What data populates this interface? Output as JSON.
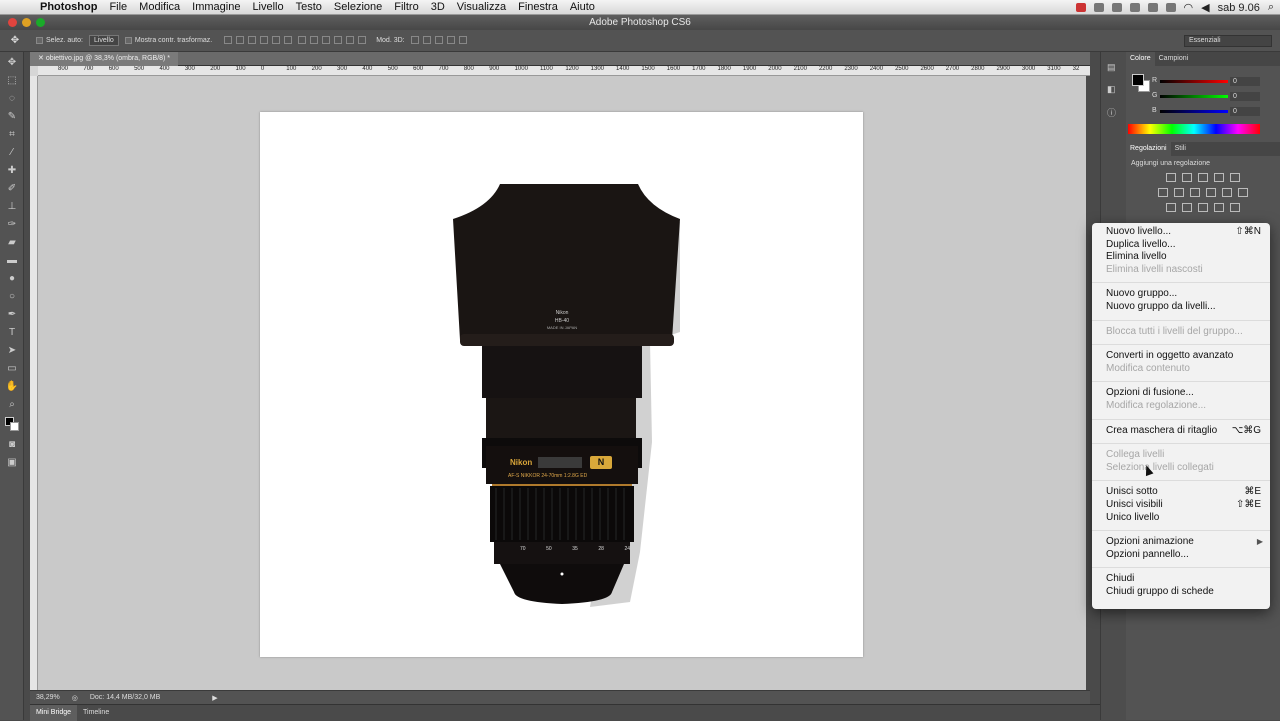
{
  "menubar": {
    "app_name": "Photoshop",
    "items": [
      "File",
      "Modifica",
      "Immagine",
      "Livello",
      "Testo",
      "Selezione",
      "Filtro",
      "3D",
      "Visualizza",
      "Finestra",
      "Aiuto"
    ],
    "clock": "sab 9.06"
  },
  "window": {
    "title": "Adobe Photoshop CS6"
  },
  "options_bar": {
    "auto_select_label": "Selez. auto:",
    "auto_select_value": "Livello",
    "transform_label": "Mostra contr. trasformaz.",
    "mode3d_label": "Mod. 3D:",
    "workspace": "Essenziali"
  },
  "document": {
    "tab_title": "obiettivo.jpg @ 38,3% (ombra, RGB/8) *",
    "ruler_ticks": [
      "800",
      "700",
      "600",
      "500",
      "400",
      "300",
      "200",
      "100",
      "0",
      "100",
      "200",
      "300",
      "400",
      "500",
      "600",
      "700",
      "800",
      "900",
      "1000",
      "1100",
      "1200",
      "1300",
      "1400",
      "1500",
      "1600",
      "1700",
      "1800",
      "1900",
      "2000",
      "2100",
      "2200",
      "2300",
      "2400",
      "2500",
      "2600",
      "2700",
      "2800",
      "2900",
      "3000",
      "3100",
      "32"
    ]
  },
  "lens": {
    "hood_brand": "Nikon",
    "hood_model": "HB-40",
    "hood_origin": "MADE IN JAPAN",
    "body_brand": "Nikon",
    "body_text": "AF-S NIKKOR 24-70mm 1:2.8G ED",
    "badge": "N",
    "focal_marks": [
      "70",
      "50",
      "35",
      "28",
      "24"
    ]
  },
  "status": {
    "zoom": "38,29%",
    "doc_info": "Doc: 14,4 MB/32,0 MB"
  },
  "bottom_tabs": [
    "Mini Bridge",
    "Timeline"
  ],
  "color_panel": {
    "tabs": [
      "Colore",
      "Campioni"
    ],
    "channels": [
      {
        "label": "R",
        "value": "0"
      },
      {
        "label": "G",
        "value": "0"
      },
      {
        "label": "B",
        "value": "0"
      }
    ]
  },
  "adjustments_panel": {
    "tabs": [
      "Regolazioni",
      "Stili"
    ],
    "heading": "Aggiungi una regolazione"
  },
  "context_menu": {
    "groups": [
      [
        {
          "label": "Nuovo livello...",
          "shortcut": "⇧⌘N",
          "enabled": true
        },
        {
          "label": "Duplica livello...",
          "shortcut": "",
          "enabled": true
        },
        {
          "label": "Elimina livello",
          "shortcut": "",
          "enabled": true
        },
        {
          "label": "Elimina livelli nascosti",
          "shortcut": "",
          "enabled": false
        }
      ],
      [
        {
          "label": "Nuovo gruppo...",
          "shortcut": "",
          "enabled": true
        },
        {
          "label": "Nuovo gruppo da livelli...",
          "shortcut": "",
          "enabled": true
        }
      ],
      [
        {
          "label": "Blocca tutti i livelli del gruppo...",
          "shortcut": "",
          "enabled": false
        }
      ],
      [
        {
          "label": "Converti in oggetto avanzato",
          "shortcut": "",
          "enabled": true
        },
        {
          "label": "Modifica contenuto",
          "shortcut": "",
          "enabled": false
        }
      ],
      [
        {
          "label": "Opzioni di fusione...",
          "shortcut": "",
          "enabled": true
        },
        {
          "label": "Modifica regolazione...",
          "shortcut": "",
          "enabled": false
        }
      ],
      [
        {
          "label": "Crea maschera di ritaglio",
          "shortcut": "⌥⌘G",
          "enabled": true
        }
      ],
      [
        {
          "label": "Collega livelli",
          "shortcut": "",
          "enabled": false
        },
        {
          "label": "Seleziona livelli collegati",
          "shortcut": "",
          "enabled": false
        }
      ],
      [
        {
          "label": "Unisci sotto",
          "shortcut": "⌘E",
          "enabled": true
        },
        {
          "label": "Unisci visibili",
          "shortcut": "⇧⌘E",
          "enabled": true
        },
        {
          "label": "Unico livello",
          "shortcut": "",
          "enabled": true
        }
      ],
      [
        {
          "label": "Opzioni animazione",
          "shortcut": "",
          "enabled": true,
          "submenu": true
        },
        {
          "label": "Opzioni pannello...",
          "shortcut": "",
          "enabled": true
        }
      ],
      [
        {
          "label": "Chiudi",
          "shortcut": "",
          "enabled": true
        },
        {
          "label": "Chiudi gruppo di schede",
          "shortcut": "",
          "enabled": true
        }
      ]
    ]
  }
}
